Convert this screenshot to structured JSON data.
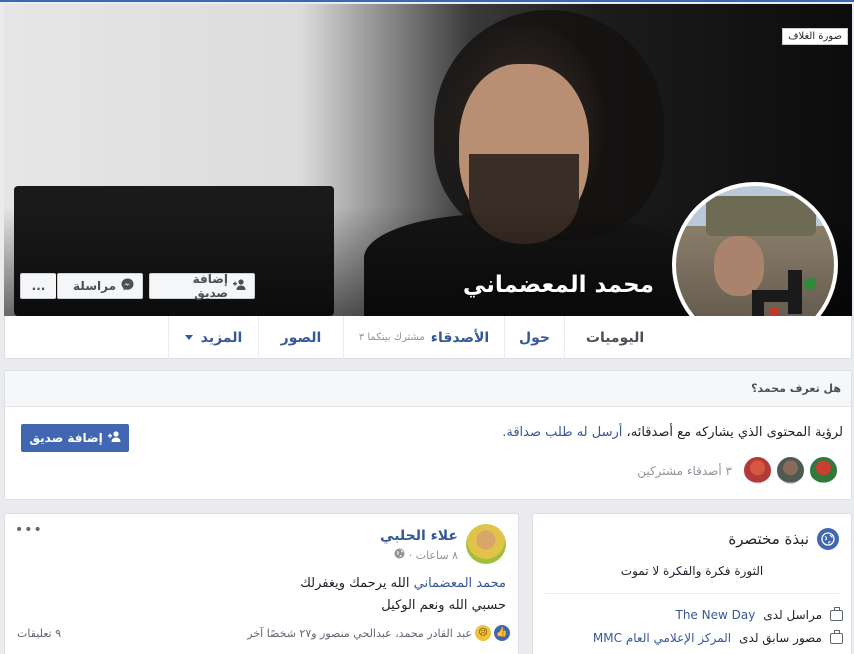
{
  "profile": {
    "name": "محمد المعضماني",
    "cover_badge": "صورة الغلاف"
  },
  "cover_buttons": {
    "add_friend": "إضافة صديق",
    "message": "مراسلة",
    "more": "..."
  },
  "nav": {
    "timeline": "اليوميات",
    "about": "حول",
    "friends": "الأصدقاء",
    "friends_sub": "مشترك بينكما ٣",
    "photos": "الصور",
    "more": "المزيد"
  },
  "know_card": {
    "heading": "هل تعرف محمد؟",
    "text": "لرؤية المحتوى الذي يشاركه مع أصدقائه، ",
    "link": "أرسل له طلب صداقة.",
    "mutual": "٣ أصدقاء مشتركين",
    "add_button": "إضافة صديق"
  },
  "post": {
    "author": "علاء الحلبي",
    "time": "٨ ساعات ·",
    "mention": "محمد المعضماني",
    "line1_rest": " الله يرحمك ويغفرلك",
    "line2": "حسبي الله ونعم الوكيل",
    "reactions_text": "عبد القادر محمد، عبدالحي منصور و٢٧ شخصًا آخر",
    "comments": "٩ تعليقات",
    "more": "•••"
  },
  "intro": {
    "title": "نبذة مختصرة",
    "bio": "الثورة فكرة والفكرة لا تموت",
    "row1_prefix": "مراسل لدى",
    "row1_link": "The New Day",
    "row2_prefix": "مصور سابق لدى",
    "row2_link": "المركز الإعلامي العام MMC"
  },
  "colors": {
    "brand": "#4267b2",
    "link": "#365899",
    "background": "#e9ebee"
  }
}
